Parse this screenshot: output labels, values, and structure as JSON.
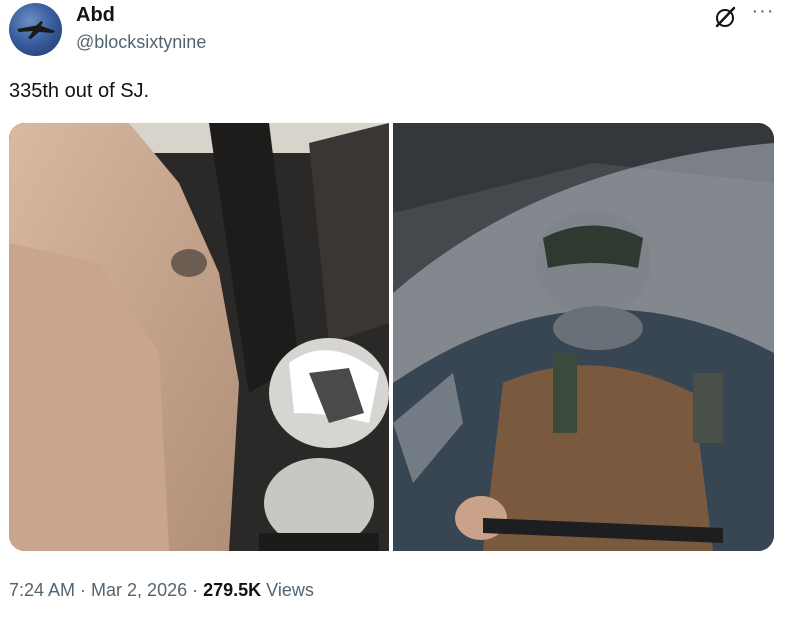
{
  "tweet": {
    "author_name": "Abd",
    "author_handle": "@blocksixtynine",
    "text": "335th out of SJ.",
    "time": "7:24 AM",
    "separator1": " · ",
    "date": "Mar 2, 2026",
    "separator2": " · ",
    "views_count": "279.5K",
    "views_label": " Views"
  },
  "icons": {
    "grok": "grok-icon",
    "more": "more-icon",
    "avatar": "jet-avatar"
  },
  "colors": {
    "text": "#0f1419",
    "secondary": "#536471",
    "background": "#ffffff"
  }
}
